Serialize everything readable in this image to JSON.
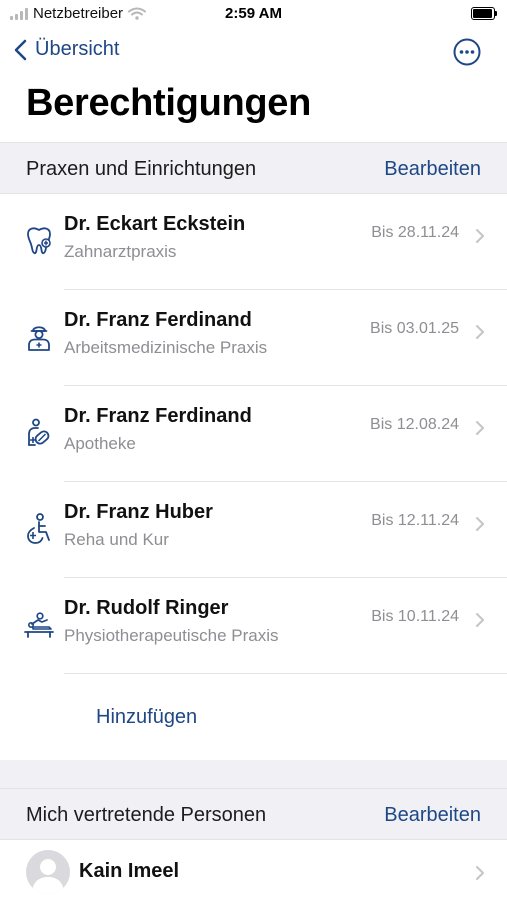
{
  "status_bar": {
    "carrier": "Netzbetreiber",
    "time": "2:59 AM"
  },
  "nav": {
    "back_label": "Übersicht",
    "more_icon": "ellipsis-circle-icon"
  },
  "page": {
    "title": "Berechtigungen"
  },
  "practices": {
    "section_title": "Praxen und Einrichtungen",
    "edit_label": "Bearbeiten",
    "items": [
      {
        "name": "Dr. Eckart Eckstein",
        "type": "Zahnarztpraxis",
        "date": "Bis 28.11.24",
        "icon": "tooth-icon"
      },
      {
        "name": "Dr. Franz Ferdinand",
        "type": "Arbeitsmedizinische Praxis",
        "date": "Bis 03.01.25",
        "icon": "occupational-doctor-icon"
      },
      {
        "name": "Dr. Franz Ferdinand",
        "type": "Apotheke",
        "date": "Bis 12.08.24",
        "icon": "pharmacy-icon"
      },
      {
        "name": "Dr. Franz Huber",
        "type": "Reha und Kur",
        "date": "Bis 12.11.24",
        "icon": "rehab-icon"
      },
      {
        "name": "Dr. Rudolf Ringer",
        "type": "Physiotherapeutische Praxis",
        "date": "Bis 10.11.24",
        "icon": "physiotherapy-icon"
      }
    ],
    "add_label": "Hinzufügen"
  },
  "representatives": {
    "section_title": "Mich vertretende Personen",
    "edit_label": "Bearbeiten",
    "items": [
      {
        "name": "Kain Imeel"
      }
    ]
  },
  "colors": {
    "accent": "#1e4785",
    "section_bg": "#f1f1f5",
    "secondary_text": "#8e8e93",
    "divider": "#e2e2e7"
  }
}
